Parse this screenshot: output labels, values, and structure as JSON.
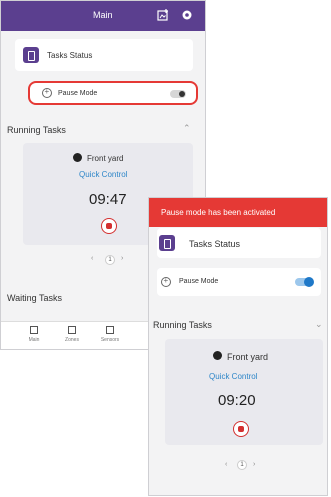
{
  "phone_before": {
    "topbar": {
      "title": "Main"
    },
    "tasks_status": {
      "title": "Tasks Status"
    },
    "pause_mode": {
      "label": "Pause Mode",
      "enabled": false
    },
    "running_tasks": {
      "title": "Running Tasks",
      "task": {
        "name": "Front yard",
        "link": "Quick Control",
        "time": "09:47"
      },
      "pager_current": "1"
    },
    "waiting_tasks": {
      "title": "Waiting Tasks"
    },
    "bottom_nav": [
      {
        "label": "Main",
        "icon": "grid-icon"
      },
      {
        "label": "Zones",
        "icon": "zones-icon"
      },
      {
        "label": "Sensors",
        "icon": "sensor-icon"
      }
    ]
  },
  "phone_after": {
    "banner": {
      "text": "Pause mode has been activated",
      "color": "#e53935"
    },
    "tasks_status": {
      "title": "Tasks Status"
    },
    "pause_mode": {
      "label": "Pause Mode",
      "enabled": true
    },
    "running_tasks": {
      "title": "Running Tasks",
      "task": {
        "name": "Front yard",
        "link": "Quick Control",
        "time": "09:20"
      },
      "pager_current": "1"
    }
  },
  "colors": {
    "primary": "#5b3f8f",
    "highlight": "#e53935",
    "link": "#2e86c8",
    "toggle_on": "#1e78c8"
  }
}
